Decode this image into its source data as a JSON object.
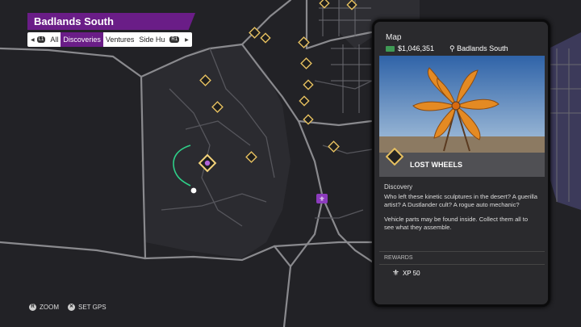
{
  "region": {
    "name": "Badlands South"
  },
  "tabs": {
    "left_button": "L1",
    "right_button": "R1",
    "items": [
      {
        "label": "All"
      },
      {
        "label": "Discoveries",
        "active": true
      },
      {
        "label": "Ventures"
      },
      {
        "label": "Side Hu"
      }
    ]
  },
  "hints": {
    "zoom": {
      "button": "R",
      "label": "ZOOM"
    },
    "gps": {
      "button": "✕",
      "label": "SET GPS"
    }
  },
  "panel": {
    "title": "Map",
    "money": "$1,046,351",
    "location": "Badlands South",
    "location_icon": "pin-icon",
    "activity_name": "LOST WHEELS",
    "category": "Discovery",
    "description_1": "Who left these kinetic sculptures in the desert? A guerilla artist? A Dustlander cult? A rogue auto mechanic?",
    "description_2": "Vehicle parts may be found inside. Collect them all to see what they assemble.",
    "rewards_label": "REWARDS",
    "reward": "XP 50",
    "reward_icon": "fleur-de-lis-icon"
  },
  "colors": {
    "accent_purple": "#6a1d87",
    "marker_gold": "#e6c060",
    "road": "#8c8c8c",
    "route": "#2ecf88"
  }
}
